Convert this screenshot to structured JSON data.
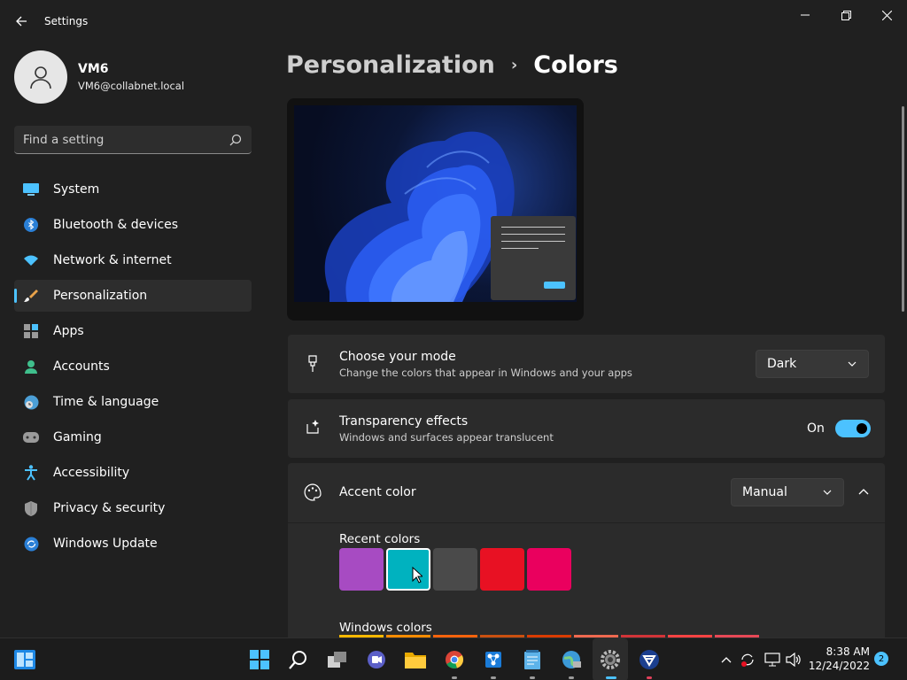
{
  "window": {
    "title": "Settings"
  },
  "profile": {
    "name": "VM6",
    "email": "VM6@collabnet.local"
  },
  "search": {
    "placeholder": "Find a setting"
  },
  "nav": {
    "items": [
      {
        "label": "System",
        "icon": "monitor-icon"
      },
      {
        "label": "Bluetooth & devices",
        "icon": "bluetooth-icon"
      },
      {
        "label": "Network & internet",
        "icon": "wifi-icon"
      },
      {
        "label": "Personalization",
        "icon": "brush-icon",
        "active": true
      },
      {
        "label": "Apps",
        "icon": "apps-icon"
      },
      {
        "label": "Accounts",
        "icon": "person-icon"
      },
      {
        "label": "Time & language",
        "icon": "clock-globe-icon"
      },
      {
        "label": "Gaming",
        "icon": "gamepad-icon"
      },
      {
        "label": "Accessibility",
        "icon": "accessibility-icon"
      },
      {
        "label": "Privacy & security",
        "icon": "shield-icon"
      },
      {
        "label": "Windows Update",
        "icon": "update-icon"
      }
    ]
  },
  "breadcrumb": {
    "parent": "Personalization",
    "separator": "›",
    "current": "Colors"
  },
  "mode": {
    "title": "Choose your mode",
    "subtitle": "Change the colors that appear in Windows and your apps",
    "value": "Dark"
  },
  "transparency": {
    "title": "Transparency effects",
    "subtitle": "Windows and surfaces appear translucent",
    "state_label": "On",
    "enabled": true
  },
  "accent": {
    "title": "Accent color",
    "value": "Manual",
    "recent_label": "Recent colors",
    "recent_colors": [
      "#a74bc2",
      "#00b2bf",
      "#4a4a4a",
      "#e81123",
      "#ea005e"
    ],
    "selected_index": 1,
    "windows_label": "Windows colors"
  },
  "colors": {
    "accent": "#4cc2ff",
    "background": "#202020",
    "card": "#2b2b2b"
  },
  "taskbar": {
    "time": "8:38 AM",
    "date": "12/24/2022",
    "notifications": "2"
  }
}
